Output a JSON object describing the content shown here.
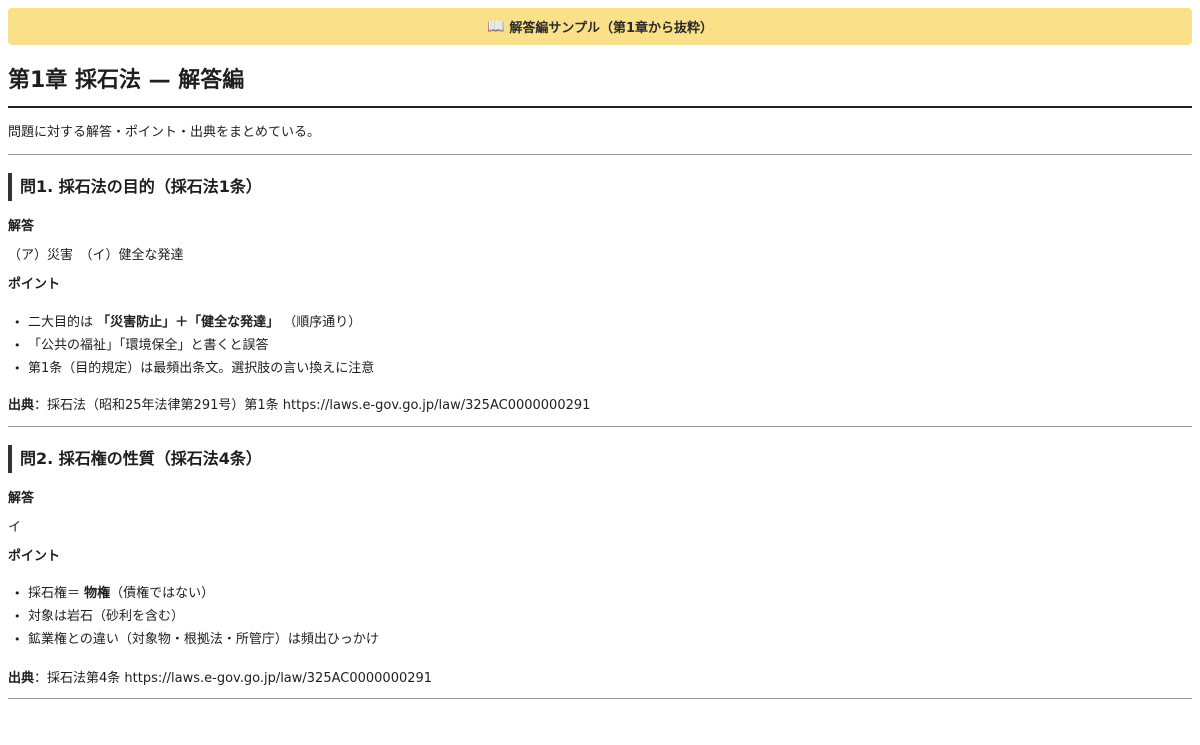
{
  "banner": {
    "icon": "book-icon",
    "text": "解答編サンプル（第1章から抜粋）"
  },
  "title": "第1章 採石法 — 解答編",
  "intro": "問題に対する解答・ポイント・出典をまとめている。",
  "questions": [
    {
      "heading": "問1. 採石法の目的（採石法1条）",
      "answer_label": "解答",
      "answer": "（ア）災害　（イ）健全な発達",
      "points_label": "ポイント",
      "points": [
        {
          "pre": "二大目的は ",
          "bold": "「災害防止」＋「健全な発達」",
          "post": " （順序通り）"
        },
        {
          "pre": "「公共の福祉」「環境保全」と書くと誤答",
          "bold": "",
          "post": ""
        },
        {
          "pre": "第1条（目的規定）は最頻出条文。選択肢の言い換えに注意",
          "bold": "",
          "post": ""
        }
      ],
      "source_label": "出典",
      "source": "：採石法（昭和25年法律第291号）第1条 https://laws.e-gov.go.jp/law/325AC0000000291"
    },
    {
      "heading": "問2. 採石権の性質（採石法4条）",
      "answer_label": "解答",
      "answer": "イ",
      "points_label": "ポイント",
      "points": [
        {
          "pre": "採石権＝ ",
          "bold": "物権",
          "post": "（債権ではない）"
        },
        {
          "pre": "対象は岩石（砂利を含む）",
          "bold": "",
          "post": ""
        },
        {
          "pre": "鉱業権との違い（対象物・根拠法・所管庁）は頻出ひっかけ",
          "bold": "",
          "post": ""
        }
      ],
      "source_label": "出典",
      "source": "：採石法第4条 https://laws.e-gov.go.jp/law/325AC0000000291"
    }
  ]
}
